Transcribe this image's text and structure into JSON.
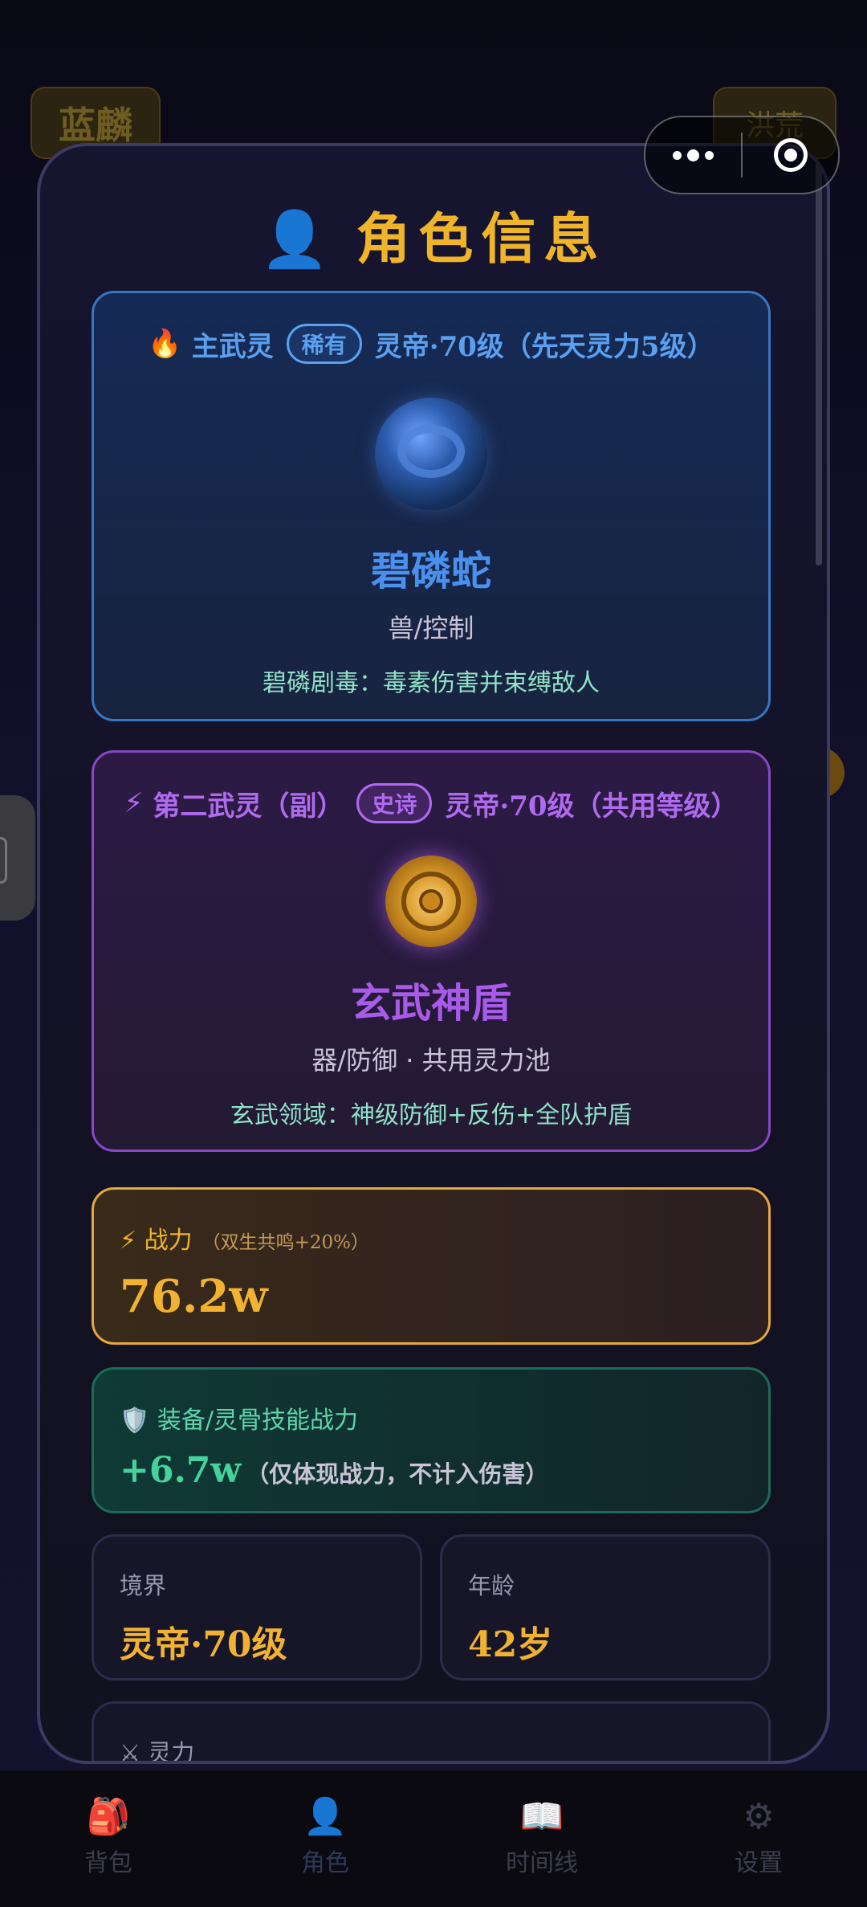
{
  "background": {
    "title": "蓝麟",
    "right_button": "洪荒"
  },
  "capsule": {
    "more_icon": "more-dots-icon",
    "close_icon": "target-close-icon"
  },
  "modal": {
    "title": "角色信息",
    "title_icon": "👤",
    "main_soul": {
      "icon": "🔥",
      "heading": "主武灵",
      "rarity": "稀有",
      "level": "灵帝·70级（先天灵力5级）",
      "name": "碧磷蛇",
      "type": "兽/控制",
      "skill": "碧磷剧毒：毒素伤害并束缚敌人"
    },
    "second_soul": {
      "icon": "⚡",
      "heading": "第二武灵（副）",
      "rarity": "史诗",
      "level": "灵帝·70级（共用等级）",
      "name": "玄武神盾",
      "type": "器/防御 · 共用灵力池",
      "skill": "玄武领域：神级防御+反伤+全队护盾"
    },
    "power": {
      "icon": "⚡",
      "label": "战力",
      "note": "（双生共鸣+20%）",
      "value": "76.2w"
    },
    "equipment": {
      "icon": "🛡️",
      "label": "装备/灵骨技能战力",
      "value": "+6.7w",
      "note": "（仅体现战力，不计入伤害）"
    },
    "realm": {
      "label": "境界",
      "value": "灵帝·70级"
    },
    "age": {
      "label": "年龄",
      "value": "42岁"
    },
    "spirit": {
      "icon": "⚔",
      "label": "灵力"
    }
  },
  "bottom_nav": [
    {
      "icon": "🎒",
      "label": "背包"
    },
    {
      "icon": "👤",
      "label": "角色"
    },
    {
      "icon": "📖",
      "label": "时间线"
    },
    {
      "icon": "⚙",
      "label": "设置"
    }
  ]
}
